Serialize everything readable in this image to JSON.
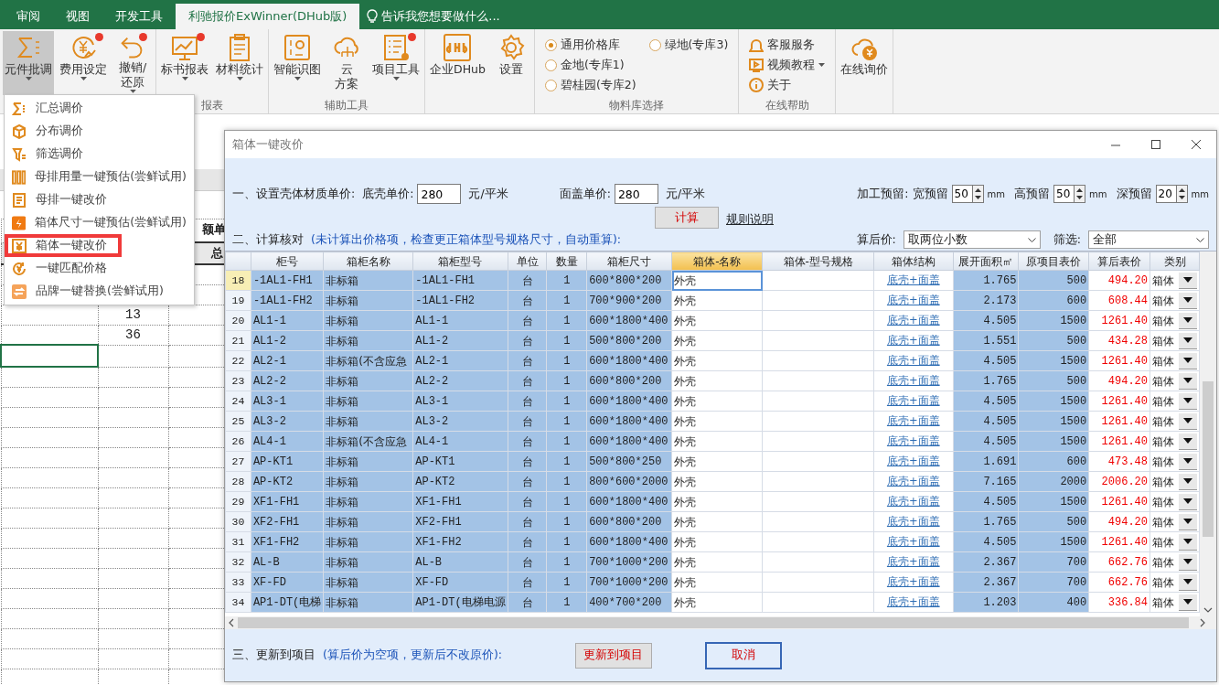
{
  "ribbon_tabs": [
    {
      "label": "审阅",
      "selected": false
    },
    {
      "label": "视图",
      "selected": false
    },
    {
      "label": "开发工具",
      "selected": false
    },
    {
      "label": "利驰报价ExWinner(DHub版)",
      "selected": true
    }
  ],
  "tell_me": {
    "placeholder": "告诉我您想要做什么..."
  },
  "ribbon_groups": [
    {
      "kind": "buttons",
      "buttons": [
        {
          "label": "元件批调",
          "caret": true,
          "notify": false,
          "pressed": true
        },
        {
          "label": "费用设定",
          "caret": true,
          "notify": true,
          "pressed": false
        },
        {
          "label": "撤销/\n还原",
          "caret": true,
          "notify": true,
          "pressed": false
        }
      ]
    },
    {
      "kind": "buttons",
      "label": "报表",
      "buttons": [
        {
          "label": "标书报表",
          "caret": true,
          "notify": true,
          "pressed": false
        },
        {
          "label": "材料统计",
          "caret": true,
          "notify": false,
          "pressed": false
        }
      ]
    },
    {
      "kind": "buttons",
      "label": "辅助工具",
      "buttons": [
        {
          "label": "智能识图",
          "caret": true,
          "notify": false,
          "pressed": false
        },
        {
          "lines": [
            "云",
            "方案"
          ],
          "caret": false,
          "notify": false,
          "pressed": false
        },
        {
          "label": "项目工具",
          "caret": true,
          "notify": true,
          "pressed": false
        }
      ]
    },
    {
      "kind": "buttons",
      "buttons": [
        {
          "label": "企业DHub",
          "caret": false,
          "notify": false,
          "pressed": false
        },
        {
          "label": "设置",
          "caret": false,
          "notify": false,
          "pressed": false
        }
      ]
    },
    {
      "kind": "radios",
      "label": "物料库选择",
      "options": [
        {
          "label": "通用价格库",
          "selected": true
        },
        {
          "label": "金地(专库1)",
          "selected": false
        },
        {
          "label": "碧桂园(专库2)",
          "selected": false
        },
        {
          "label": "绿地(专库3)",
          "selected": false
        }
      ]
    },
    {
      "kind": "links",
      "label": "在线帮助",
      "links": [
        {
          "label": "客服服务",
          "caret": false
        },
        {
          "label": "视频教程",
          "caret": true
        },
        {
          "label": "关于",
          "caret": false
        }
      ]
    },
    {
      "kind": "buttons",
      "buttons": [
        {
          "label": "在线询价",
          "caret": false,
          "notify": false,
          "pressed": false
        }
      ]
    }
  ],
  "dropdown_menu": [
    {
      "label": "汇总调价",
      "highlighted": false
    },
    {
      "label": "分布调价",
      "highlighted": false
    },
    {
      "label": "筛选调价",
      "highlighted": false
    },
    {
      "label": "母排用量一键预估(尝鲜试用)",
      "highlighted": false
    },
    {
      "label": "母排一键改价",
      "highlighted": false
    },
    {
      "label": "箱体尺寸一键预估(尝鲜试用)",
      "highlighted": false
    },
    {
      "label": "箱体一键改价",
      "highlighted": true
    },
    {
      "label": "一键匹配价格",
      "highlighted": false
    },
    {
      "label": "品牌一键替换(尝鲜试用)",
      "highlighted": false
    }
  ],
  "sheet": {
    "headers": [
      "额单",
      "总"
    ],
    "values": [
      "13",
      "36"
    ]
  },
  "dialog": {
    "title": "箱体一键改价",
    "section1": {
      "label": "一、设置壳体材质单价:",
      "fields": [
        {
          "label": "底壳单价:",
          "value": "280",
          "unit": "元/平米"
        },
        {
          "label": "面盖单价:",
          "value": "280",
          "unit": "元/平米"
        }
      ],
      "margin_label": "加工预留:",
      "spinners": [
        {
          "label": "宽预留",
          "value": "50",
          "unit": "mm"
        },
        {
          "label": "高预留",
          "value": "50",
          "unit": "mm"
        },
        {
          "label": "深预留",
          "value": "20",
          "unit": "mm"
        }
      ]
    },
    "calc_button": "计算",
    "rules_link": "规则说明",
    "section2": {
      "label": "二、计算核对",
      "hint": "(未计算出价格项，检查更正箱体型号规格尺寸，自动重算):",
      "rounding": {
        "label": "算后价:",
        "value": "取两位小数"
      },
      "filter": {
        "label": "筛选:",
        "value": "全部"
      }
    },
    "table": {
      "columns": [
        {
          "label": "柜号",
          "shaded": true,
          "selected": false
        },
        {
          "label": "箱柜名称",
          "shaded": true,
          "selected": false
        },
        {
          "label": "箱柜型号",
          "shaded": true,
          "selected": false
        },
        {
          "label": "单位",
          "shaded": true,
          "selected": false
        },
        {
          "label": "数量",
          "shaded": true,
          "selected": false
        },
        {
          "label": "箱柜尺寸",
          "shaded": true,
          "selected": false
        },
        {
          "label": "箱体-名称",
          "shaded": false,
          "selected": true
        },
        {
          "label": "箱体-型号规格",
          "shaded": false,
          "selected": false
        },
        {
          "label": "箱体结构",
          "shaded": false,
          "selected": false
        },
        {
          "label": "展开面积㎡",
          "shaded": true,
          "selected": false
        },
        {
          "label": "原项目表价",
          "shaded": true,
          "selected": false
        },
        {
          "label": "算后表价",
          "shaded": false,
          "selected": false
        },
        {
          "label": "类别",
          "shaded": false,
          "selected": false
        }
      ],
      "rows": [
        {
          "no": "18",
          "selected": true,
          "cabinet_no": "-1AL1-FH1",
          "name": "非标箱",
          "model": "-1AL1-FH1",
          "unit": "台",
          "qty": "1",
          "size": "600*800*200",
          "box_name": "外壳",
          "structure": "底壳+面盖",
          "area": "1.765",
          "orig_price": "500",
          "calc_price": "494.20",
          "category": "箱体"
        },
        {
          "no": "19",
          "selected": false,
          "cabinet_no": "-1AL1-FH2",
          "name": "非标箱",
          "model": "-1AL1-FH2",
          "unit": "台",
          "qty": "1",
          "size": "700*900*200",
          "box_name": "外壳",
          "structure": "底壳+面盖",
          "area": "2.173",
          "orig_price": "600",
          "calc_price": "608.44",
          "category": "箱体"
        },
        {
          "no": "20",
          "selected": false,
          "cabinet_no": "AL1-1",
          "name": "非标箱",
          "model": "AL1-1",
          "unit": "台",
          "qty": "1",
          "size": "600*1800*400",
          "box_name": "外壳",
          "structure": "底壳+面盖",
          "area": "4.505",
          "orig_price": "1500",
          "calc_price": "1261.40",
          "category": "箱体"
        },
        {
          "no": "21",
          "selected": false,
          "cabinet_no": "AL1-2",
          "name": "非标箱",
          "model": "AL1-2",
          "unit": "台",
          "qty": "1",
          "size": "500*800*200",
          "box_name": "外壳",
          "structure": "底壳+面盖",
          "area": "1.551",
          "orig_price": "500",
          "calc_price": "434.28",
          "category": "箱体"
        },
        {
          "no": "22",
          "selected": false,
          "cabinet_no": "AL2-1",
          "name": "非标箱(不含应急",
          "model": "AL2-1",
          "unit": "台",
          "qty": "1",
          "size": "600*1800*400",
          "box_name": "外壳",
          "structure": "底壳+面盖",
          "area": "4.505",
          "orig_price": "1500",
          "calc_price": "1261.40",
          "category": "箱体"
        },
        {
          "no": "23",
          "selected": false,
          "cabinet_no": "AL2-2",
          "name": "非标箱",
          "model": "AL2-2",
          "unit": "台",
          "qty": "1",
          "size": "600*800*200",
          "box_name": "外壳",
          "structure": "底壳+面盖",
          "area": "1.765",
          "orig_price": "500",
          "calc_price": "494.20",
          "category": "箱体"
        },
        {
          "no": "24",
          "selected": false,
          "cabinet_no": "AL3-1",
          "name": "非标箱",
          "model": "AL3-1",
          "unit": "台",
          "qty": "1",
          "size": "600*1800*400",
          "box_name": "外壳",
          "structure": "底壳+面盖",
          "area": "4.505",
          "orig_price": "1500",
          "calc_price": "1261.40",
          "category": "箱体"
        },
        {
          "no": "25",
          "selected": false,
          "cabinet_no": "AL3-2",
          "name": "非标箱",
          "model": "AL3-2",
          "unit": "台",
          "qty": "1",
          "size": "600*1800*400",
          "box_name": "外壳",
          "structure": "底壳+面盖",
          "area": "4.505",
          "orig_price": "1500",
          "calc_price": "1261.40",
          "category": "箱体"
        },
        {
          "no": "26",
          "selected": false,
          "cabinet_no": "AL4-1",
          "name": "非标箱(不含应急",
          "model": "AL4-1",
          "unit": "台",
          "qty": "1",
          "size": "600*1800*400",
          "box_name": "外壳",
          "structure": "底壳+面盖",
          "area": "4.505",
          "orig_price": "1500",
          "calc_price": "1261.40",
          "category": "箱体"
        },
        {
          "no": "27",
          "selected": false,
          "cabinet_no": "AP-KT1",
          "name": "非标箱",
          "model": "AP-KT1",
          "unit": "台",
          "qty": "1",
          "size": "500*800*250",
          "box_name": "外壳",
          "structure": "底壳+面盖",
          "area": "1.691",
          "orig_price": "600",
          "calc_price": "473.48",
          "category": "箱体"
        },
        {
          "no": "28",
          "selected": false,
          "cabinet_no": "AP-KT2",
          "name": "非标箱",
          "model": "AP-KT2",
          "unit": "台",
          "qty": "1",
          "size": "800*600*2000",
          "box_name": "外壳",
          "structure": "底壳+面盖",
          "area": "7.165",
          "orig_price": "2000",
          "calc_price": "2006.20",
          "category": "箱体"
        },
        {
          "no": "29",
          "selected": false,
          "cabinet_no": "XF1-FH1",
          "name": "非标箱",
          "model": "XF1-FH1",
          "unit": "台",
          "qty": "1",
          "size": "600*1800*400",
          "box_name": "外壳",
          "structure": "底壳+面盖",
          "area": "4.505",
          "orig_price": "1500",
          "calc_price": "1261.40",
          "category": "箱体"
        },
        {
          "no": "30",
          "selected": false,
          "cabinet_no": "XF2-FH1",
          "name": "非标箱",
          "model": "XF2-FH1",
          "unit": "台",
          "qty": "1",
          "size": "600*800*200",
          "box_name": "外壳",
          "structure": "底壳+面盖",
          "area": "1.765",
          "orig_price": "500",
          "calc_price": "494.20",
          "category": "箱体"
        },
        {
          "no": "31",
          "selected": false,
          "cabinet_no": "XF1-FH2",
          "name": "非标箱",
          "model": "XF1-FH2",
          "unit": "台",
          "qty": "1",
          "size": "600*1800*400",
          "box_name": "外壳",
          "structure": "底壳+面盖",
          "area": "4.505",
          "orig_price": "1500",
          "calc_price": "1261.40",
          "category": "箱体"
        },
        {
          "no": "32",
          "selected": false,
          "cabinet_no": "AL-B",
          "name": "非标箱",
          "model": "AL-B",
          "unit": "台",
          "qty": "1",
          "size": "700*1000*200",
          "box_name": "外壳",
          "structure": "底壳+面盖",
          "area": "2.367",
          "orig_price": "700",
          "calc_price": "662.76",
          "category": "箱体"
        },
        {
          "no": "33",
          "selected": false,
          "cabinet_no": "XF-FD",
          "name": "非标箱",
          "model": "XF-FD",
          "unit": "台",
          "qty": "1",
          "size": "700*1000*200",
          "box_name": "外壳",
          "structure": "底壳+面盖",
          "area": "2.367",
          "orig_price": "700",
          "calc_price": "662.76",
          "category": "箱体"
        },
        {
          "no": "34",
          "selected": false,
          "cabinet_no": "AP1-DT(电梯",
          "name": "非标箱",
          "model": "AP1-DT(电梯电源",
          "unit": "台",
          "qty": "1",
          "size": "400*700*200",
          "box_name": "外壳",
          "structure": "底壳+面盖",
          "area": "1.203",
          "orig_price": "400",
          "calc_price": "336.84",
          "category": "箱体"
        }
      ]
    },
    "section3": {
      "label": "三、更新到项目",
      "hint": "(算后价为空项，更新后不改原价):",
      "buttons": [
        {
          "label": "更新到项目",
          "kind": "flat"
        },
        {
          "label": "取消",
          "kind": "outline"
        }
      ]
    }
  }
}
